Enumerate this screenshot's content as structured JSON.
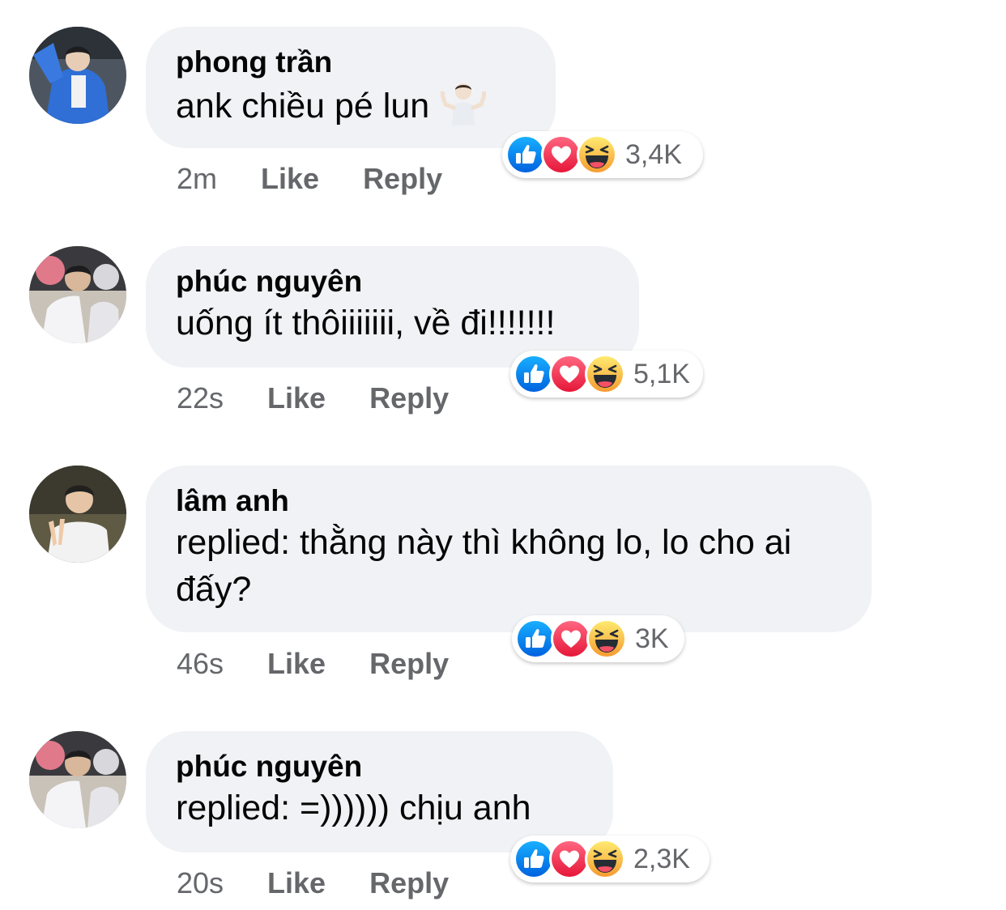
{
  "comments": [
    {
      "name": "phong trần",
      "text": "ank chiều pé lun",
      "emoji": "man-shrugging-emoji",
      "time": "2m",
      "like": "Like",
      "reply": "Reply",
      "reaction_count": "3,4K",
      "reactions": [
        "like-reaction-icon",
        "love-reaction-icon",
        "haha-reaction-icon"
      ]
    },
    {
      "name": "phúc nguyên",
      "text": "uống ít thôiiiiiii, về đi!!!!!!!",
      "time": "22s",
      "like": "Like",
      "reply": "Reply",
      "reaction_count": "5,1K",
      "reactions": [
        "like-reaction-icon",
        "love-reaction-icon",
        "haha-reaction-icon"
      ]
    },
    {
      "name": "lâm anh",
      "text": "replied: thằng này thì không lo, lo cho ai đấy?",
      "time": "46s",
      "like": "Like",
      "reply": "Reply",
      "reaction_count": "3K",
      "reactions": [
        "like-reaction-icon",
        "love-reaction-icon",
        "haha-reaction-icon"
      ]
    },
    {
      "name": "phúc nguyên",
      "text": "replied: =)))))) chịu anh",
      "time": "20s",
      "like": "Like",
      "reply": "Reply",
      "reaction_count": "2,3K",
      "reactions": [
        "like-reaction-icon",
        "love-reaction-icon",
        "haha-reaction-icon"
      ]
    }
  ],
  "colors": {
    "bubble": "#f0f2f5",
    "meta_text": "#65676b",
    "like_blue": "#1877f2",
    "love_red": "#f33e58",
    "haha_yellow": "#f7b125"
  }
}
